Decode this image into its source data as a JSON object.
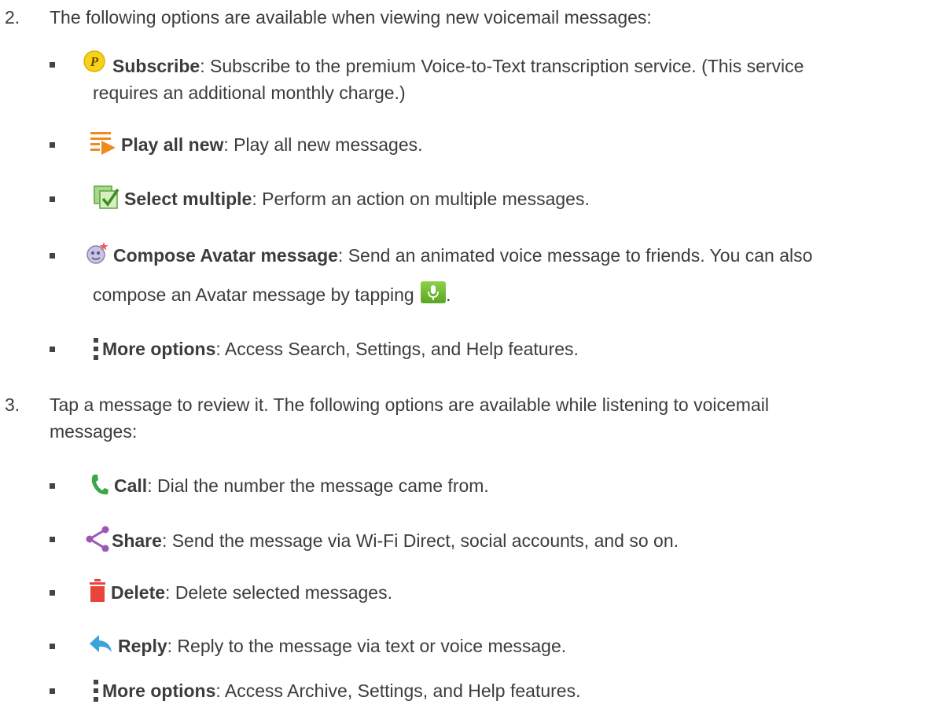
{
  "step2": {
    "number": "2.",
    "text": "The following options are available when viewing new voicemail messages:",
    "items": [
      {
        "icon": "subscribe-icon",
        "bold": "Subscribe",
        "desc": ": Subscribe to the premium Voice-to-Text transcription service. (This service",
        "desc2": "requires an additional monthly charge.)"
      },
      {
        "icon": "play-all-icon",
        "bold": "Play all new",
        "desc": ": Play all new messages."
      },
      {
        "icon": "select-multiple-icon",
        "bold": "Select multiple",
        "desc": ": Perform an action on multiple messages."
      },
      {
        "icon": "avatar-icon",
        "bold": "Compose Avatar message",
        "desc": ": Send an animated voice message to friends. You can also",
        "desc2": "compose an Avatar message by tapping",
        "desc2_end": "."
      },
      {
        "icon": "more-options-icon",
        "bold": "More options",
        "desc": ": Access Search, Settings, and Help features."
      }
    ]
  },
  "step3": {
    "number": "3.",
    "text": "Tap a message to review it. The following options are available while listening to voicemail",
    "text2": "messages:",
    "items": [
      {
        "icon": "call-icon",
        "bold": "Call",
        "desc": ": Dial the number the message came from."
      },
      {
        "icon": "share-icon",
        "bold": "Share",
        "desc": ": Send the message via Wi-Fi Direct, social accounts, and so on."
      },
      {
        "icon": "delete-icon",
        "bold": "Delete",
        "desc": ": Delete selected messages."
      },
      {
        "icon": "reply-icon",
        "bold": "Reply",
        "desc": ": Reply to the message via text or voice message."
      },
      {
        "icon": "more-options-icon",
        "bold": "More options",
        "desc": ": Access Archive, Settings, and Help features."
      }
    ]
  },
  "colors": {
    "text": "#3c3c3c",
    "mic_button": "#6cbf2e",
    "call": "#3aa84a",
    "share": "#9b59b6",
    "delete": "#e8443a",
    "reply": "#3aa3dc",
    "subscribe": "#f5c400",
    "play_all": "#f08a1c",
    "select_multiple": "#7cc04a"
  }
}
